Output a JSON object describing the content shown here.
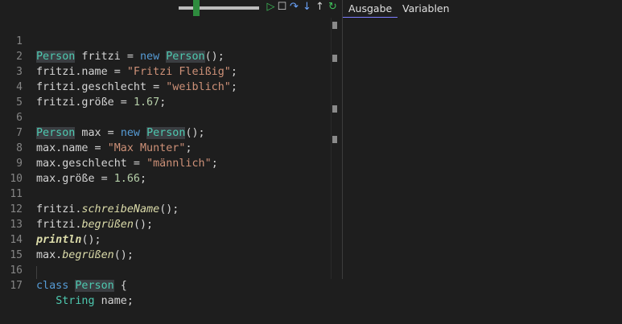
{
  "toolbar": {
    "icons": [
      "play-icon",
      "stop-icon",
      "step-over-icon",
      "step-into-icon",
      "step-out-icon",
      "restart-icon"
    ],
    "glyphs": {
      "play": "▷",
      "stop": "☐",
      "step_over": "↷",
      "step_into": "↓",
      "step_out": "↑",
      "restart": "↻"
    }
  },
  "editor": {
    "lines": [
      {
        "n": "1"
      },
      {
        "n": "2"
      },
      {
        "n": "3"
      },
      {
        "n": "4"
      },
      {
        "n": "5"
      },
      {
        "n": "6"
      },
      {
        "n": "7"
      },
      {
        "n": "8"
      },
      {
        "n": "9"
      },
      {
        "n": "10"
      },
      {
        "n": "11"
      },
      {
        "n": "12"
      },
      {
        "n": "13"
      },
      {
        "n": "14"
      },
      {
        "n": "15"
      },
      {
        "n": "16"
      },
      {
        "n": "17"
      }
    ],
    "code": {
      "l1": {
        "a": "Person",
        "b": " fritzi = ",
        "c": "new",
        "d": " ",
        "e": "Person",
        "f": "();"
      },
      "l2": {
        "a": "fritzi.name = ",
        "b": "\"Fritzi Fleißig\"",
        "c": ";"
      },
      "l3": {
        "a": "fritzi.geschlecht = ",
        "b": "\"weiblich\"",
        "c": ";"
      },
      "l4": {
        "a": "fritzi.größe = ",
        "b": "1.67",
        "c": ";"
      },
      "l6": {
        "a": "Person",
        "b": " max = ",
        "c": "new",
        "d": " ",
        "e": "Person",
        "f": "();"
      },
      "l7": {
        "a": "max.name = ",
        "b": "\"Max Munter\"",
        "c": ";"
      },
      "l8": {
        "a": "max.geschlecht = ",
        "b": "\"männlich\"",
        "c": ";"
      },
      "l9": {
        "a": "max.größe = ",
        "b": "1.66",
        "c": ";"
      },
      "l11": {
        "a": "fritzi.",
        "b": "schreibeName",
        "c": "();"
      },
      "l12": {
        "a": "fritzi.",
        "b": "begrüßen",
        "c": "();"
      },
      "l13": {
        "a": "println",
        "b": "();"
      },
      "l14": {
        "a": "max.",
        "b": "begrüßen",
        "c": "();"
      },
      "l16": {
        "a": "class",
        "b": " ",
        "c": "Person",
        "d": " {"
      },
      "l17": {
        "a": "   ",
        "b": "String",
        "c": " name;"
      }
    }
  },
  "right_panel": {
    "tabs": [
      {
        "label": "Ausgabe",
        "active": true
      },
      {
        "label": "Variablen",
        "active": false
      }
    ]
  },
  "colors": {
    "background": "#1e1e1e",
    "keyword": "#569cd6",
    "class": "#4ec9b0",
    "string": "#ce9178",
    "number": "#b5cea8",
    "tab_underline": "#7c7cff",
    "play": "#3fbf5a"
  }
}
